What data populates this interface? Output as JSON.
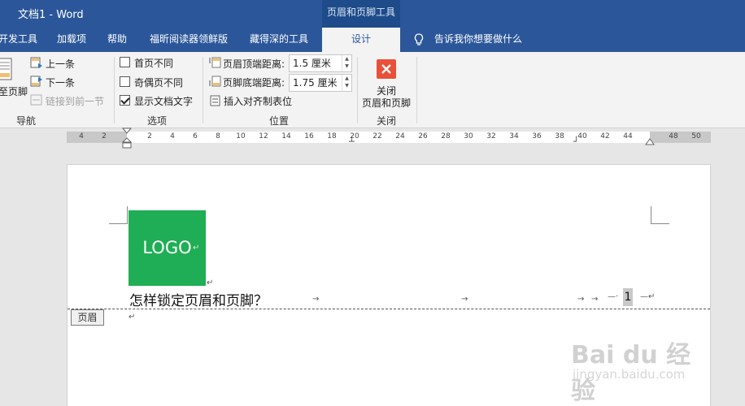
{
  "window": {
    "title": "文档1  -  Word",
    "contextual_tab_group": "页眉和页脚工具"
  },
  "tabs": [
    {
      "label": "开发工具"
    },
    {
      "label": "加载项"
    },
    {
      "label": "帮助"
    },
    {
      "label": "福昕阅读器领鲜版"
    },
    {
      "label": "藏得深的工具"
    },
    {
      "label": "设计",
      "active": true
    }
  ],
  "tellme": {
    "label": "告诉我你想要做什么",
    "icon": "lightbulb-icon"
  },
  "ribbon": {
    "navigation": {
      "goto_footer": "至页脚",
      "previous": "上一条",
      "next": "下一条",
      "link_previous": "链接到前一节",
      "group_label": "导航"
    },
    "options": {
      "different_first_page": "首页不同",
      "different_odd_even": "奇偶页不同",
      "show_document_text": "显示文档文字",
      "different_first_page_checked": false,
      "different_odd_even_checked": false,
      "show_document_text_checked": true,
      "group_label": "选项"
    },
    "position": {
      "header_top_label": "页眉顶端距离:",
      "header_top_value": "1.5 厘米",
      "footer_bottom_label": "页脚底端距离:",
      "footer_bottom_value": "1.75 厘米",
      "insert_alignment_tab": "插入对齐制表位",
      "group_label": "位置"
    },
    "close": {
      "label_line1": "关闭",
      "label_line2": "页眉和页脚",
      "group_label": "关闭",
      "icon": "close-icon",
      "icon_color": "#e8503a"
    }
  },
  "ruler": {
    "numbers": [
      "4",
      "2",
      "2",
      "4",
      "6",
      "8",
      "10",
      "12",
      "14",
      "16",
      "18",
      "20",
      "22",
      "24",
      "26",
      "28",
      "30",
      "32",
      "34",
      "36",
      "38",
      "40",
      "42",
      "44",
      "48",
      "50"
    ]
  },
  "document": {
    "logo_text": "LOGO",
    "logo_color": "#1fae55",
    "header_text": "怎样锁定页眉和页脚？",
    "page_number": "1",
    "header_label": "页眉"
  },
  "watermark": {
    "brand": "Bai du 经验",
    "url": "jingyan.baidu.com"
  },
  "colors": {
    "accent": "#2b579a",
    "ribbon_bg": "#f3f3f3"
  }
}
